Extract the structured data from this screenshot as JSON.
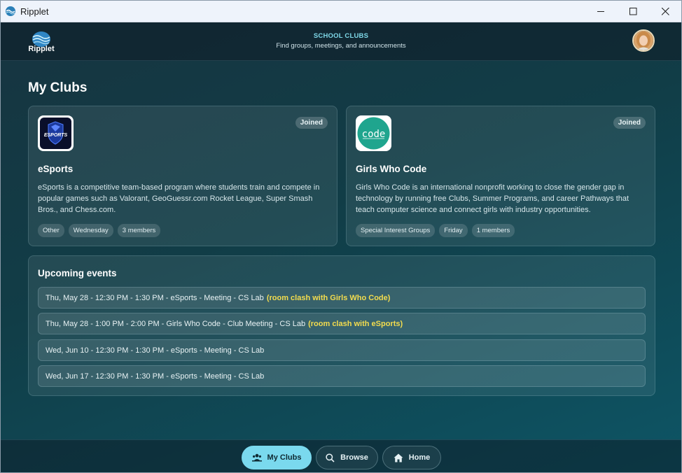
{
  "window": {
    "title": "Ripplet"
  },
  "header": {
    "logo_text": "Ripplet",
    "kicker": "SCHOOL CLUBS",
    "subtitle": "Find groups, meetings, and announcements"
  },
  "page": {
    "title": "My Clubs"
  },
  "clubs": [
    {
      "name": "eSports",
      "badge": "Joined",
      "logo_text": "ESPORTS",
      "description": "eSports is a competitive team-based program where students train and compete in popular games such as Valorant, GeoGuessr.com Rocket League, Super Smash Bros., and Chess.com.",
      "tags": [
        "Other",
        "Wednesday",
        "3 members"
      ]
    },
    {
      "name": "Girls Who Code",
      "badge": "Joined",
      "logo_text": "code",
      "description": "Girls Who Code is an international nonprofit working to close the gender gap in technology by running free Clubs, Summer Programs, and career Pathways that teach computer science and connect girls with industry opportunities.",
      "tags": [
        "Special Interest Groups",
        "Friday",
        "1 members"
      ]
    }
  ],
  "events": {
    "heading": "Upcoming events",
    "items": [
      {
        "text": "Thu, May 28 - 12:30 PM - 1:30 PM - eSports - Meeting - CS Lab",
        "clash": "(room clash with Girls Who Code)"
      },
      {
        "text": "Thu, May 28 - 1:00 PM - 2:00 PM - Girls Who Code - Club Meeting - CS Lab",
        "clash": "(room clash with eSports)"
      },
      {
        "text": "Wed, Jun 10 - 12:30 PM - 1:30 PM - eSports - Meeting - CS Lab",
        "clash": ""
      },
      {
        "text": "Wed, Jun 17 - 12:30 PM - 1:30 PM - eSports - Meeting - CS Lab",
        "clash": ""
      }
    ]
  },
  "nav": {
    "my_clubs": "My Clubs",
    "browse": "Browse",
    "home": "Home"
  },
  "colors": {
    "accent": "#7ad9ee",
    "clash": "#f3dc4e",
    "kicker": "#7fd9e9"
  }
}
